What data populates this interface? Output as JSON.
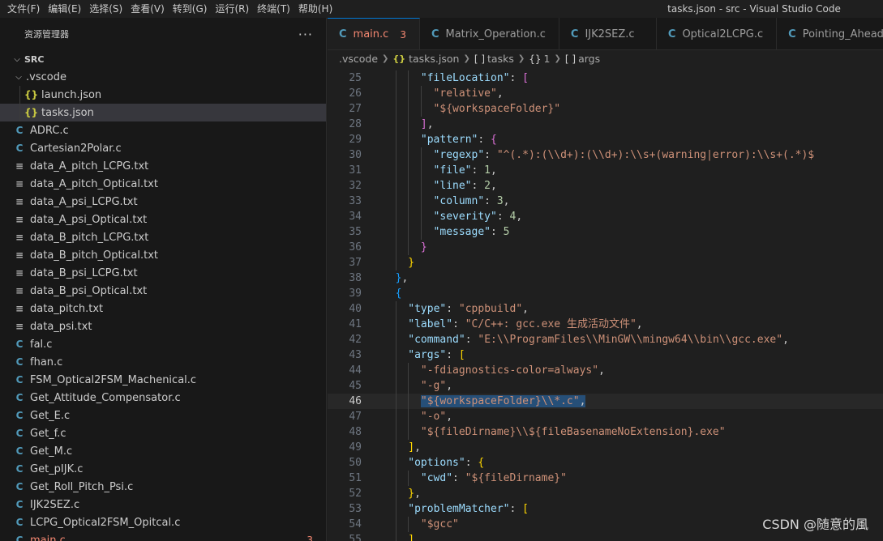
{
  "menu": [
    "文件(F)",
    "编辑(E)",
    "选择(S)",
    "查看(V)",
    "转到(G)",
    "运行(R)",
    "终端(T)",
    "帮助(H)"
  ],
  "window_title": "tasks.json - src - Visual Studio Code",
  "sidebar": {
    "title": "资源管理器",
    "more": "···",
    "root": "SRC",
    "items": [
      {
        "label": ".vscode",
        "type": "folder",
        "level": 1,
        "expanded": true
      },
      {
        "label": "launch.json",
        "type": "json",
        "level": 2
      },
      {
        "label": "tasks.json",
        "type": "json",
        "level": 2,
        "active": true
      },
      {
        "label": "ADRC.c",
        "type": "c",
        "level": 1
      },
      {
        "label": "Cartesian2Polar.c",
        "type": "c",
        "level": 1
      },
      {
        "label": "data_A_pitch_LCPG.txt",
        "type": "txt",
        "level": 1
      },
      {
        "label": "data_A_pitch_Optical.txt",
        "type": "txt",
        "level": 1
      },
      {
        "label": "data_A_psi_LCPG.txt",
        "type": "txt",
        "level": 1
      },
      {
        "label": "data_A_psi_Optical.txt",
        "type": "txt",
        "level": 1
      },
      {
        "label": "data_B_pitch_LCPG.txt",
        "type": "txt",
        "level": 1
      },
      {
        "label": "data_B_pitch_Optical.txt",
        "type": "txt",
        "level": 1
      },
      {
        "label": "data_B_psi_LCPG.txt",
        "type": "txt",
        "level": 1
      },
      {
        "label": "data_B_psi_Optical.txt",
        "type": "txt",
        "level": 1
      },
      {
        "label": "data_pitch.txt",
        "type": "txt",
        "level": 1
      },
      {
        "label": "data_psi.txt",
        "type": "txt",
        "level": 1
      },
      {
        "label": "fal.c",
        "type": "c",
        "level": 1
      },
      {
        "label": "fhan.c",
        "type": "c",
        "level": 1
      },
      {
        "label": "FSM_Optical2FSM_Machenical.c",
        "type": "c",
        "level": 1
      },
      {
        "label": "Get_Attitude_Compensator.c",
        "type": "c",
        "level": 1
      },
      {
        "label": "Get_E.c",
        "type": "c",
        "level": 1
      },
      {
        "label": "Get_f.c",
        "type": "c",
        "level": 1
      },
      {
        "label": "Get_M.c",
        "type": "c",
        "level": 1
      },
      {
        "label": "Get_pIJK.c",
        "type": "c",
        "level": 1
      },
      {
        "label": "Get_Roll_Pitch_Psi.c",
        "type": "c",
        "level": 1
      },
      {
        "label": "IJK2SEZ.c",
        "type": "c",
        "level": 1
      },
      {
        "label": "LCPG_Optical2FSM_Opitcal.c",
        "type": "c",
        "level": 1
      },
      {
        "label": "main.c",
        "type": "c",
        "level": 1,
        "modified": true,
        "badge": "3"
      }
    ]
  },
  "tabs": [
    {
      "label": "main.c",
      "active": true,
      "badge": "3"
    },
    {
      "label": "Matrix_Operation.c"
    },
    {
      "label": "IJK2SEZ.c"
    },
    {
      "label": "Optical2LCPG.c"
    },
    {
      "label": "Pointing_Ahead_S"
    }
  ],
  "breadcrumb": {
    "folder": ".vscode",
    "file": "tasks.json",
    "sym1": "tasks",
    "sym2": "1",
    "sym3": "args",
    "icon_json": "{}",
    "icon_array": "[ ]",
    "icon_obj": "{}"
  },
  "editor": {
    "current_line": 46,
    "lines": [
      {
        "n": "25",
        "indent": 6,
        "t": [
          [
            "k",
            "\"fileLocation\""
          ],
          [
            "p",
            ": "
          ],
          [
            "b2",
            "["
          ]
        ]
      },
      {
        "n": "26",
        "indent": 8,
        "t": [
          [
            "s",
            "\"relative\""
          ],
          [
            "p",
            ","
          ]
        ]
      },
      {
        "n": "27",
        "indent": 8,
        "t": [
          [
            "s",
            "\"${workspaceFolder}\""
          ]
        ]
      },
      {
        "n": "28",
        "indent": 6,
        "t": [
          [
            "b2",
            "]"
          ],
          [
            "p",
            ","
          ]
        ]
      },
      {
        "n": "29",
        "indent": 6,
        "t": [
          [
            "k",
            "\"pattern\""
          ],
          [
            "p",
            ": "
          ],
          [
            "b2",
            "{"
          ]
        ]
      },
      {
        "n": "30",
        "indent": 8,
        "t": [
          [
            "k",
            "\"regexp\""
          ],
          [
            "p",
            ": "
          ],
          [
            "s",
            "\"^(.*):(\\\\d+):(\\\\d+):\\\\s+(warning|error):\\\\s+(.*)$"
          ]
        ]
      },
      {
        "n": "31",
        "indent": 8,
        "t": [
          [
            "k",
            "\"file\""
          ],
          [
            "p",
            ": "
          ],
          [
            "n",
            "1"
          ],
          [
            "p",
            ","
          ]
        ]
      },
      {
        "n": "32",
        "indent": 8,
        "t": [
          [
            "k",
            "\"line\""
          ],
          [
            "p",
            ": "
          ],
          [
            "n",
            "2"
          ],
          [
            "p",
            ","
          ]
        ]
      },
      {
        "n": "33",
        "indent": 8,
        "t": [
          [
            "k",
            "\"column\""
          ],
          [
            "p",
            ": "
          ],
          [
            "n",
            "3"
          ],
          [
            "p",
            ","
          ]
        ]
      },
      {
        "n": "34",
        "indent": 8,
        "t": [
          [
            "k",
            "\"severity\""
          ],
          [
            "p",
            ": "
          ],
          [
            "n",
            "4"
          ],
          [
            "p",
            ","
          ]
        ]
      },
      {
        "n": "35",
        "indent": 8,
        "t": [
          [
            "k",
            "\"message\""
          ],
          [
            "p",
            ": "
          ],
          [
            "n",
            "5"
          ]
        ]
      },
      {
        "n": "36",
        "indent": 6,
        "t": [
          [
            "b2",
            "}"
          ]
        ]
      },
      {
        "n": "37",
        "indent": 4,
        "t": [
          [
            "b1",
            "}"
          ]
        ]
      },
      {
        "n": "38",
        "indent": 2,
        "t": [
          [
            "b3",
            "}"
          ],
          [
            "p",
            ","
          ]
        ]
      },
      {
        "n": "39",
        "indent": 2,
        "t": [
          [
            "b3",
            "{"
          ]
        ]
      },
      {
        "n": "40",
        "indent": 4,
        "t": [
          [
            "k",
            "\"type\""
          ],
          [
            "p",
            ": "
          ],
          [
            "s",
            "\"cppbuild\""
          ],
          [
            "p",
            ","
          ]
        ]
      },
      {
        "n": "41",
        "indent": 4,
        "t": [
          [
            "k",
            "\"label\""
          ],
          [
            "p",
            ": "
          ],
          [
            "s",
            "\"C/C++: gcc.exe 生成活动文件\""
          ],
          [
            "p",
            ","
          ]
        ]
      },
      {
        "n": "42",
        "indent": 4,
        "t": [
          [
            "k",
            "\"command\""
          ],
          [
            "p",
            ": "
          ],
          [
            "s",
            "\"E:\\\\ProgramFiles\\\\MinGW\\\\mingw64\\\\bin\\\\gcc.exe\""
          ],
          [
            "p",
            ","
          ]
        ]
      },
      {
        "n": "43",
        "indent": 4,
        "t": [
          [
            "k",
            "\"args\""
          ],
          [
            "p",
            ": "
          ],
          [
            "b1",
            "["
          ]
        ]
      },
      {
        "n": "44",
        "indent": 6,
        "t": [
          [
            "s",
            "\"-fdiagnostics-color=always\""
          ],
          [
            "p",
            ","
          ]
        ]
      },
      {
        "n": "45",
        "indent": 6,
        "t": [
          [
            "s",
            "\"-g\""
          ],
          [
            "p",
            ","
          ]
        ]
      },
      {
        "n": "46",
        "indent": 6,
        "t": [
          [
            "s sel",
            "\"${workspaceFolder}\\\\*.c\""
          ],
          [
            "p sel",
            ","
          ]
        ]
      },
      {
        "n": "47",
        "indent": 6,
        "t": [
          [
            "s",
            "\"-o\""
          ],
          [
            "p",
            ","
          ]
        ]
      },
      {
        "n": "48",
        "indent": 6,
        "t": [
          [
            "s",
            "\"${fileDirname}\\\\${fileBasenameNoExtension}.exe\""
          ]
        ]
      },
      {
        "n": "49",
        "indent": 4,
        "t": [
          [
            "b1",
            "]"
          ],
          [
            "p",
            ","
          ]
        ]
      },
      {
        "n": "50",
        "indent": 4,
        "t": [
          [
            "k",
            "\"options\""
          ],
          [
            "p",
            ": "
          ],
          [
            "b1",
            "{"
          ]
        ]
      },
      {
        "n": "51",
        "indent": 6,
        "t": [
          [
            "k",
            "\"cwd\""
          ],
          [
            "p",
            ": "
          ],
          [
            "s",
            "\"${fileDirname}\""
          ]
        ]
      },
      {
        "n": "52",
        "indent": 4,
        "t": [
          [
            "b1",
            "}"
          ],
          [
            "p",
            ","
          ]
        ]
      },
      {
        "n": "53",
        "indent": 4,
        "t": [
          [
            "k",
            "\"problemMatcher\""
          ],
          [
            "p",
            ": "
          ],
          [
            "b1",
            "["
          ]
        ]
      },
      {
        "n": "54",
        "indent": 6,
        "t": [
          [
            "s",
            "\"$gcc\""
          ]
        ]
      },
      {
        "n": "55",
        "indent": 4,
        "t": [
          [
            "b1",
            "]"
          ],
          [
            "p",
            ","
          ]
        ]
      }
    ]
  },
  "watermark": "CSDN @随意的風",
  "colors": {
    "accent": "#0078d4",
    "modified": "#f48771",
    "c_icon": "#519aba",
    "json_icon": "#cbcb41"
  }
}
